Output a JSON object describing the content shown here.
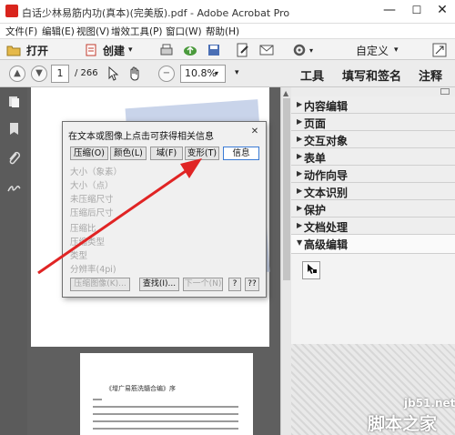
{
  "window": {
    "title": "白话少林易筋内功(真本)(完美版).pdf - Adobe Acrobat Pro",
    "minimize": "—",
    "maximize": "☐",
    "close": "✕"
  },
  "menu": [
    "文件(F)",
    "编辑(E)",
    "视图(V)",
    "增效工具(P)",
    "窗口(W)",
    "帮助(H)"
  ],
  "toolbar": {
    "open_label": "打开",
    "create_label": "创建",
    "custom_label": "自定义"
  },
  "nav": {
    "page_current": "1",
    "page_total": "/ 266",
    "zoom": "10.8%",
    "tabs": [
      "工具",
      "填写和签名",
      "注释"
    ]
  },
  "right_panel": {
    "sections": [
      "内容编辑",
      "页面",
      "交互对象",
      "表单",
      "动作向导",
      "文本识别",
      "保护",
      "文档处理",
      "高级编辑"
    ]
  },
  "dialog": {
    "title": "在文本或图像上点击可获得相关信息",
    "tabs": [
      "压缩(O)",
      "颜色(L)",
      "域(F)",
      "变形(T)",
      "信息"
    ],
    "active_tab": "信息",
    "info_lines": [
      "大小（象素）",
      "大小（点）",
      "未压缩尺寸",
      "压缩后尺寸",
      "压缩比",
      "压缩类型",
      "类型",
      "分辨率(4pi)"
    ],
    "buttons": {
      "compress_image": "压缩图像(K)...",
      "find": "查找(I)...",
      "next": "下一个(N)",
      "help": "?",
      "help2": "??"
    }
  },
  "document": {
    "page2_title": "《增广易筋洗髓合编》序"
  },
  "watermark": {
    "line1": "jb51.net",
    "line2": "脚本之家"
  },
  "colors": {
    "arrow": "#e02424",
    "dialog_active_border": "#3a7bd5",
    "left_nav": "#5b5b5b"
  }
}
